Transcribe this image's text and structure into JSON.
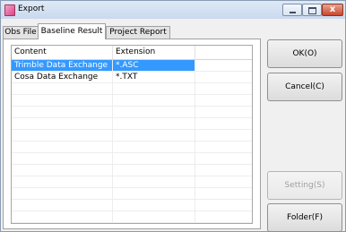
{
  "window": {
    "title": "Export"
  },
  "tabs": [
    {
      "label": "Obs File"
    },
    {
      "label": "Baseline Result"
    },
    {
      "label": "Project Report"
    }
  ],
  "table": {
    "columns": [
      "Content",
      "Extension"
    ],
    "rows": [
      {
        "content": "Trimble Data Exchange",
        "extension": "*.ASC",
        "selected": true
      },
      {
        "content": "Cosa Data Exchange",
        "extension": "*.TXT",
        "selected": false
      }
    ]
  },
  "buttons": {
    "ok": "OK(O)",
    "cancel": "Cancel(C)",
    "setting": "Setting(S)",
    "folder": "Folder(F)"
  },
  "title_buttons": {
    "close": "x"
  },
  "colors": {
    "selection": "#3399ff"
  }
}
